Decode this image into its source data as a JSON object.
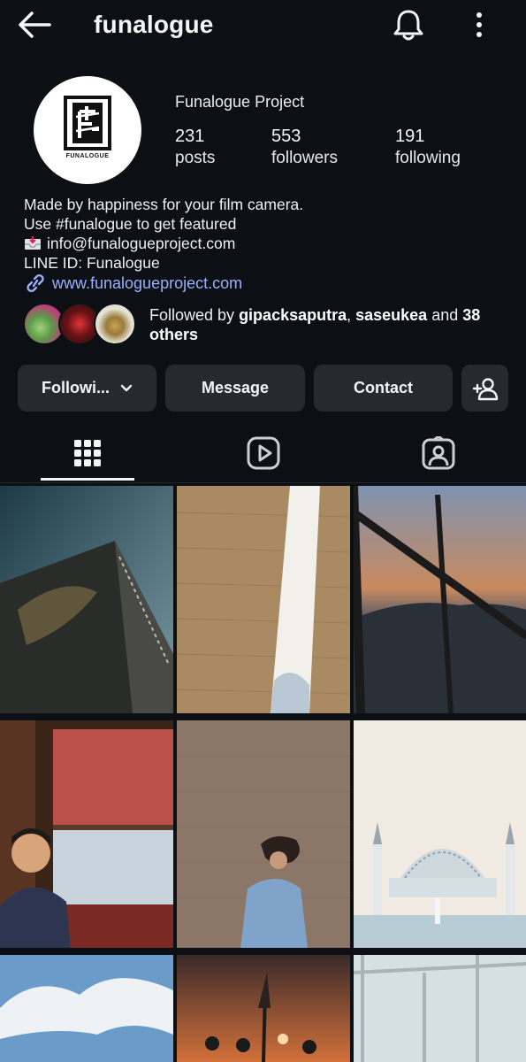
{
  "header": {
    "username": "funalogue",
    "back_icon": "arrow-left-icon",
    "notification_icon": "bell-icon",
    "menu_icon": "more-vertical-icon"
  },
  "profile": {
    "avatar_caption": "FUNALOGUE",
    "display_name": "Funalogue Project",
    "stats": {
      "posts": {
        "value": "231",
        "label": "posts"
      },
      "followers": {
        "value": "553",
        "label": "followers"
      },
      "following": {
        "value": "191",
        "label": "following"
      }
    },
    "bio": {
      "line1": "Made by happiness for your film camera.",
      "line2": "Use #funalogue to get featured",
      "line3": "info@funalogueproject.com",
      "line4": "LINE ID: Funalogue"
    },
    "link": "www.funalogueproject.com",
    "followed_by": {
      "prefix": "Followed by ",
      "user1": "gipacksaputra",
      "sep": ", ",
      "user2": "saseukea",
      "mid": " and ",
      "others": "38 others"
    }
  },
  "actions": {
    "following_label": "Followi...",
    "message_label": "Message",
    "contact_label": "Contact",
    "add_user_icon": "add-user-icon"
  },
  "tabs": [
    "grid-icon",
    "reels-icon",
    "tagged-icon"
  ],
  "colors": {
    "background": "#0c1014",
    "button": "#262a2f",
    "link": "#9ab0ff",
    "text": "#f5f5f5"
  }
}
